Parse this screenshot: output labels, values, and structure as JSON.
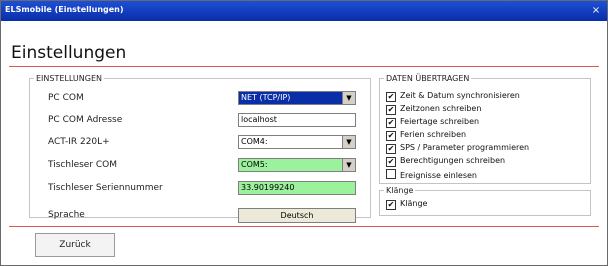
{
  "window": {
    "title": "ELSmobile (Einstellungen)",
    "close_symbol": "×"
  },
  "page": {
    "title": "Einstellungen"
  },
  "settings": {
    "legend": "EINSTELLUNGEN",
    "rows": [
      {
        "label": "PC COM",
        "value": "NET (TCP/IP)"
      },
      {
        "label": "PC COM Adresse",
        "value": "localhost"
      },
      {
        "label": "ACT-IR 220L+",
        "value": "COM4:"
      },
      {
        "label": "Tischleser COM",
        "value": "COM5:"
      },
      {
        "label": "Tischleser Seriennummer",
        "value": "33.90199240"
      },
      {
        "label": "Sprache",
        "value": "Deutsch"
      }
    ]
  },
  "daten": {
    "legend": "DATEN ÜBERTRAGEN",
    "items": [
      {
        "label": "Zeit & Datum synchronisieren",
        "checked": true
      },
      {
        "label": "Zeitzonen schreiben",
        "checked": true
      },
      {
        "label": "Feiertage schreiben",
        "checked": true
      },
      {
        "label": "Ferien schreiben",
        "checked": true
      },
      {
        "label": "SPS / Parameter programmieren",
        "checked": true
      },
      {
        "label": "Berechtigungen schreiben",
        "checked": true
      },
      {
        "label": "Ereignisse einlesen",
        "checked": false
      }
    ]
  },
  "klaenge": {
    "legend": "Klänge",
    "items": [
      {
        "label": "Klänge",
        "checked": true
      }
    ]
  },
  "footer": {
    "back_label": "Zurück"
  },
  "colors": {
    "titlebar": "#0a2ea8",
    "accent_rule": "#d45a5a",
    "field_green": "#9cf29c"
  }
}
